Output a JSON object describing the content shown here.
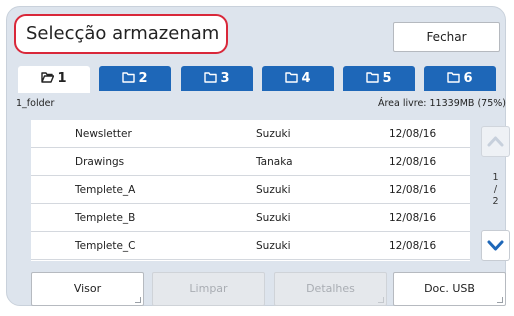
{
  "header": {
    "title": "Selecção armazenam",
    "close_label": "Fechar"
  },
  "tabs": [
    {
      "label": "1",
      "icon": "folder-open-icon",
      "active": true
    },
    {
      "label": "2",
      "icon": "folder-icon",
      "active": false
    },
    {
      "label": "3",
      "icon": "folder-icon",
      "active": false
    },
    {
      "label": "4",
      "icon": "folder-icon",
      "active": false
    },
    {
      "label": "5",
      "icon": "folder-icon",
      "active": false
    },
    {
      "label": "6",
      "icon": "folder-icon",
      "active": false
    }
  ],
  "folder": {
    "name": "1_folder",
    "free_space": "Área livre: 11339MB (75%)"
  },
  "files": [
    {
      "name": "Newsletter",
      "user": "Suzuki",
      "date": "12/08/16"
    },
    {
      "name": "Drawings",
      "user": "Tanaka",
      "date": "12/08/16"
    },
    {
      "name": "Templete_A",
      "user": "Suzuki",
      "date": "12/08/16"
    },
    {
      "name": "Templete_B",
      "user": "Suzuki",
      "date": "12/08/16"
    },
    {
      "name": "Templete_C",
      "user": "Suzuki",
      "date": "12/08/16"
    }
  ],
  "pager": {
    "current": "1",
    "separator": "/",
    "total": "2"
  },
  "buttons": {
    "viewer": "Visor",
    "clear": "Limpar",
    "details": "Detalhes",
    "usb": "Doc. USB"
  },
  "colors": {
    "accent_tab": "#1e67b8",
    "title_border": "#d9283a",
    "panel_bg": "#dde4ed",
    "scroll_arrow": "#1e67b8",
    "scroll_arrow_disabled": "#c7d0dc"
  }
}
